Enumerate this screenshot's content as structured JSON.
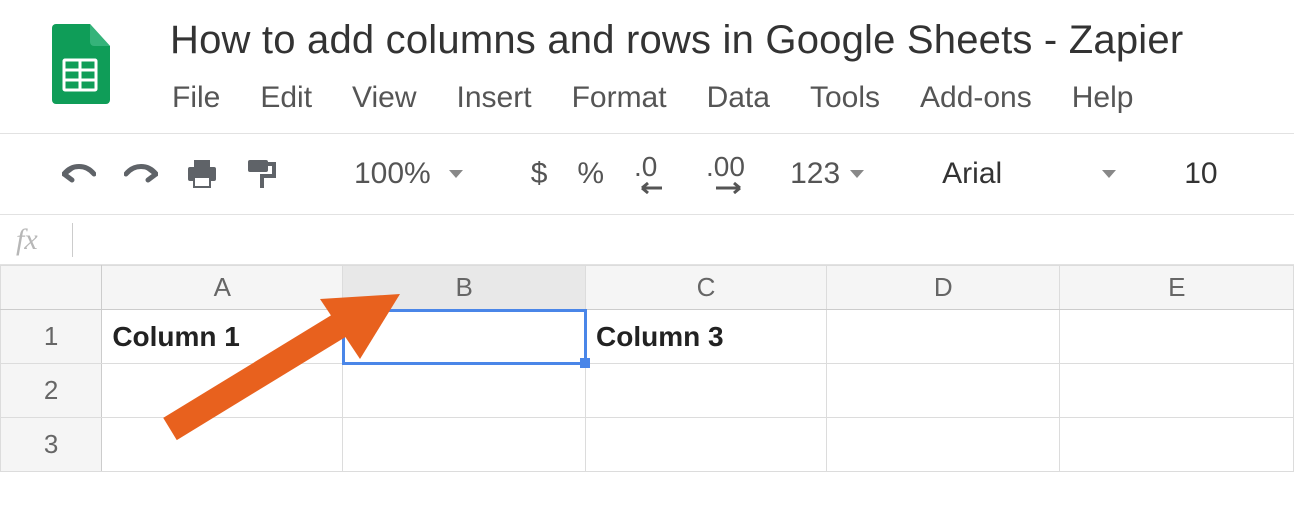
{
  "document": {
    "title": "How to add columns and rows in Google Sheets - Zapier"
  },
  "menu": {
    "file": "File",
    "edit": "Edit",
    "view": "View",
    "insert": "Insert",
    "format": "Format",
    "data": "Data",
    "tools": "Tools",
    "addons": "Add-ons",
    "help": "Help"
  },
  "toolbar": {
    "zoom": "100%",
    "currency": "$",
    "percent": "%",
    "dec_less": ".0",
    "dec_more": ".00",
    "numfmt": "123",
    "font": "Arial",
    "font_size": "10"
  },
  "formula_bar": {
    "fx": "fx",
    "value": ""
  },
  "columns": [
    "A",
    "B",
    "C",
    "D",
    "E"
  ],
  "rows": [
    "1",
    "2",
    "3"
  ],
  "selected_column_index": 1,
  "selected_cell": "B1",
  "cells": {
    "A1": "Column 1",
    "B1": "",
    "C1": "Column 3",
    "D1": "",
    "E1": "",
    "A2": "",
    "B2": "",
    "C2": "",
    "D2": "",
    "E2": "",
    "A3": "",
    "B3": "",
    "C3": "",
    "D3": "",
    "E3": ""
  },
  "annotation": {
    "arrow_color": "#e8611e"
  }
}
